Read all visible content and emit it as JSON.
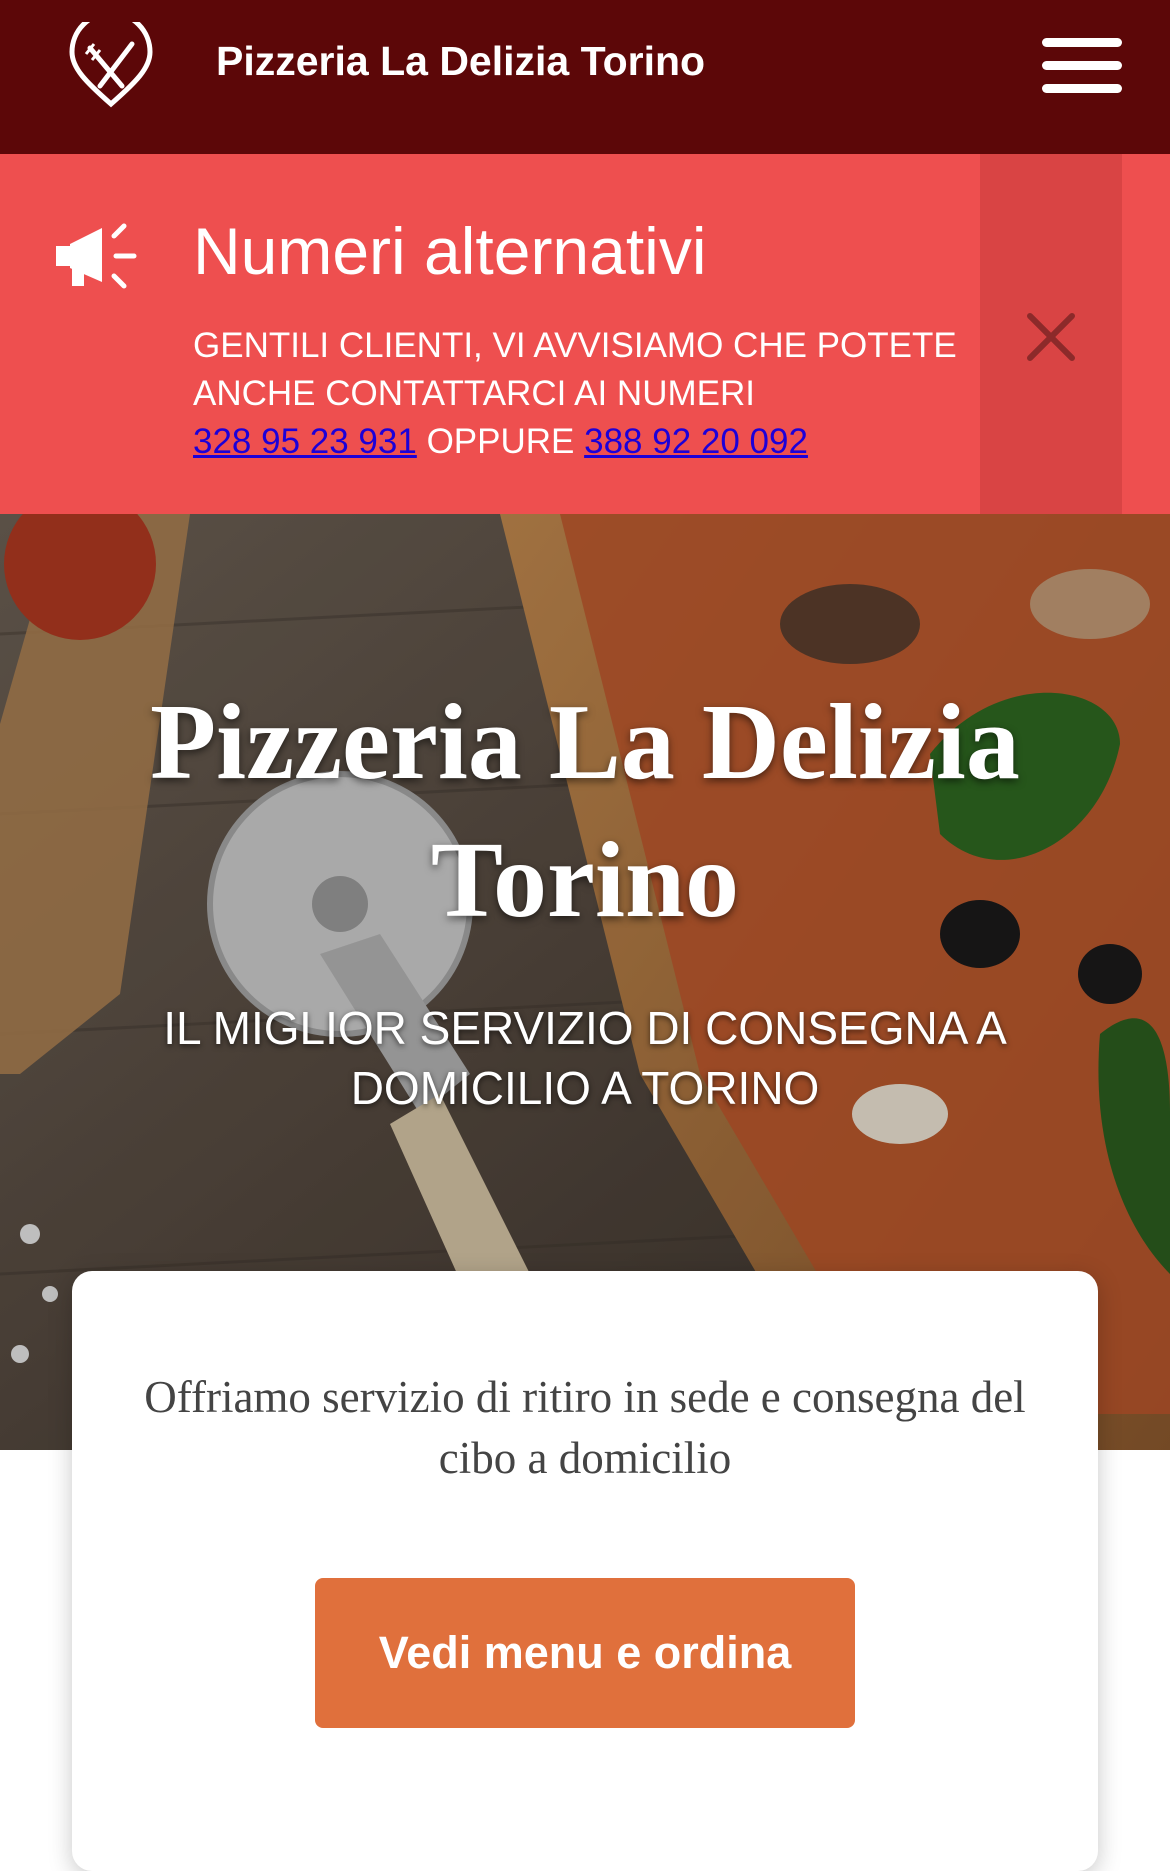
{
  "header": {
    "brand": "Pizzeria La Delizia Torino",
    "logo_icon": "fork-knife-icon",
    "menu_icon": "hamburger-menu-icon",
    "background": "#5c0708"
  },
  "notice": {
    "icon": "megaphone-icon",
    "title": "Numeri alternativi",
    "text_line1": "GENTILI CLIENTI, VI AVVISIAMO CHE POTETE ANCHE CONTATTARCI AI NUMERI",
    "phone1": "328 95 23 931",
    "joiner": "OPPURE",
    "phone2": "388 92 20 092",
    "close_icon": "close-icon",
    "background": "#ee4f4f"
  },
  "hero": {
    "title": "Pizzeria La Delizia Torino",
    "subtitle": "IL MIGLIOR SERVIZIO DI CONSEGNA A DOMICILIO A TORINO"
  },
  "card": {
    "text": "Offriamo servizio di ritiro in sede e consegna del cibo a domicilio",
    "cta_label": "Vedi menu e ordina",
    "cta_color": "#e0703c"
  }
}
